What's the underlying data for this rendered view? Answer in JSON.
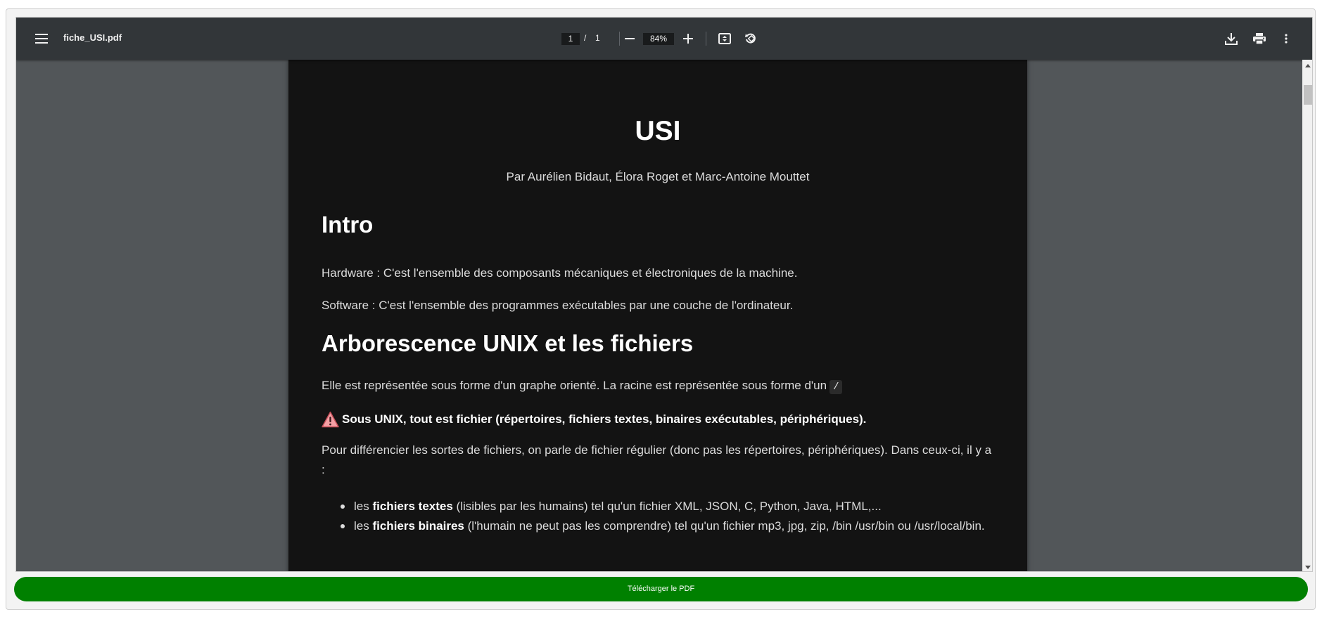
{
  "toolbar": {
    "file_name": "fiche_USI.pdf",
    "page_current": "1",
    "page_separator": "/",
    "page_total": "1",
    "zoom": "84%",
    "icons": [
      "menu-icon",
      "zoom-out-icon",
      "zoom-in-icon",
      "fit-page-icon",
      "rotate-icon",
      "download-icon",
      "print-icon",
      "more-vert-icon"
    ]
  },
  "document": {
    "title": "USI",
    "authors": "Par Aurélien Bidaut, Élora Roget et Marc-Antoine Mouttet",
    "h_intro": "Intro",
    "hardware": "Hardware : C'est l'ensemble des composants mécaniques et électroniques de la machine.",
    "software": "Software : C'est l'ensemble des programmes exécutables par une couche de l'ordinateur.",
    "h_unix": "Arborescence UNIX et les fichiers",
    "graph_text": "Elle est représentée sous forme d'un graphe orienté. La racine est représentée sous forme d'un",
    "root_symbol": "/",
    "warning": "Sous UNIX, tout est fichier (répertoires, fichiers textes, binaires exécutables, périphériques).",
    "diff_text": "Pour différencier les sortes de fichiers, on parle de fichier régulier (donc pas les répertoires, périphériques). Dans ceux-ci, il y a :",
    "bullets": [
      {
        "prefix": "les ",
        "bold": "fichiers textes",
        "rest": " (lisibles par les humains) tel qu'un fichier XML, JSON, C, Python, Java, HTML,..."
      },
      {
        "prefix": "les ",
        "bold": "fichiers binaires",
        "rest": " (l'humain ne peut pas les comprendre) tel qu'un fichier mp3, jpg, zip, /bin /usr/bin ou /usr/local/bin."
      }
    ]
  },
  "download_button": "Télécharger le PDF",
  "colors": {
    "toolbar_bg": "#323639",
    "viewer_bg": "#525659",
    "page_bg": "#131313",
    "button_bg": "#008000"
  }
}
